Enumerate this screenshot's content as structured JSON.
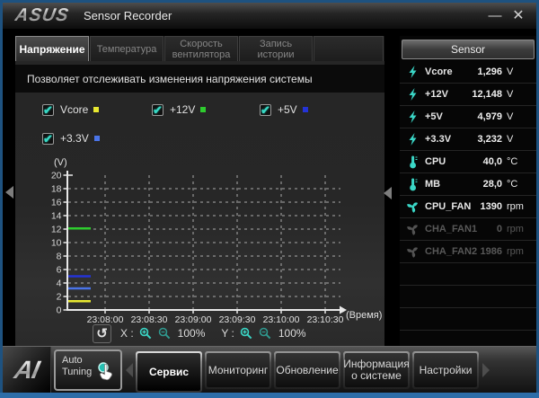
{
  "window": {
    "brand": "ASUS",
    "title": "Sensor Recorder",
    "minimize_label": "—",
    "close_label": "✕"
  },
  "tabs": [
    {
      "label": "Напряжение",
      "active": true
    },
    {
      "label": "Температура",
      "active": false
    },
    {
      "label": "Скорость вентилятора",
      "active": false
    },
    {
      "label": "Запись истории",
      "active": false
    }
  ],
  "description": "Позволяет отслеживать изменения напряжения системы",
  "legend": [
    {
      "label": "Vcore",
      "color": "#e8e830",
      "checked": true,
      "check_glyph": "✔"
    },
    {
      "label": "+12V",
      "color": "#2ecc2e",
      "checked": true,
      "check_glyph": "✔"
    },
    {
      "label": "+5V",
      "color": "#2433d6",
      "checked": true,
      "check_glyph": "✔"
    },
    {
      "label": "+3.3V",
      "color": "#4a74e8",
      "checked": true,
      "check_glyph": "✔"
    }
  ],
  "chart_data": {
    "type": "line",
    "title": "",
    "ylabel": "(V)",
    "xlabel": "(Время)",
    "ylim": [
      0,
      20
    ],
    "ytick_step": 2,
    "x_ticks": [
      "23:08:00",
      "23:08:30",
      "23:09:00",
      "23:09:30",
      "23:10:00",
      "23:10:30"
    ],
    "grid": true,
    "legend_position": "none",
    "series": [
      {
        "name": "+12V",
        "color": "#2ecc2e",
        "value": 12.1
      },
      {
        "name": "+5V",
        "color": "#2433d6",
        "value": 5.0
      },
      {
        "name": "+3.3V",
        "color": "#4a74e8",
        "value": 3.2
      },
      {
        "name": "Vcore",
        "color": "#e8e830",
        "value": 1.3
      }
    ],
    "note": "Recording just started: each series is a short flat segment at the left edge of the plot, before the 23:08:00 tick."
  },
  "chart_controls": {
    "reset_glyph": "↺",
    "x_label": "X :",
    "x_zoom": "100%",
    "y_label": "Y :",
    "y_zoom": "100%"
  },
  "sensor_panel": {
    "header": "Sensor",
    "rows": [
      {
        "icon": "voltage-icon",
        "label": "Vcore",
        "value": "1,296",
        "unit": "V",
        "state": "active"
      },
      {
        "icon": "voltage-icon",
        "label": "+12V",
        "value": "12,148",
        "unit": "V",
        "state": "active"
      },
      {
        "icon": "voltage-icon",
        "label": "+5V",
        "value": "4,979",
        "unit": "V",
        "state": "active"
      },
      {
        "icon": "voltage-icon",
        "label": "+3.3V",
        "value": "3,232",
        "unit": "V",
        "state": "active"
      },
      {
        "icon": "temperature-icon",
        "label": "CPU",
        "value": "40,0",
        "unit": "°C",
        "state": "active"
      },
      {
        "icon": "temperature-icon",
        "label": "MB",
        "value": "28,0",
        "unit": "°C",
        "state": "active"
      },
      {
        "icon": "fan-icon",
        "label": "CPU_FAN",
        "value": "1390",
        "unit": "rpm",
        "state": "active"
      },
      {
        "icon": "fan-icon",
        "label": "CHA_FAN1",
        "value": "0",
        "unit": "rpm",
        "state": "inactive"
      },
      {
        "icon": "fan-icon",
        "label": "CHA_FAN2",
        "value": "1986",
        "unit": "rpm",
        "state": "inactive"
      }
    ]
  },
  "bottom_bar": {
    "ai_logo": "AI",
    "auto_tuning_label": "Auto\nTuning",
    "nav": [
      {
        "label": "Сервис",
        "active": true
      },
      {
        "label": "Мониторинг",
        "active": false
      },
      {
        "label": "Обновление",
        "active": false
      },
      {
        "label": "Информация о системе",
        "active": false
      },
      {
        "label": "Настройки",
        "active": false
      }
    ]
  },
  "colors": {
    "accent_teal": "#3ad6c6",
    "window_border": "#1e5280",
    "window_border_bottom": "#2d6da8",
    "panel_bg": "#2b2b2b"
  }
}
